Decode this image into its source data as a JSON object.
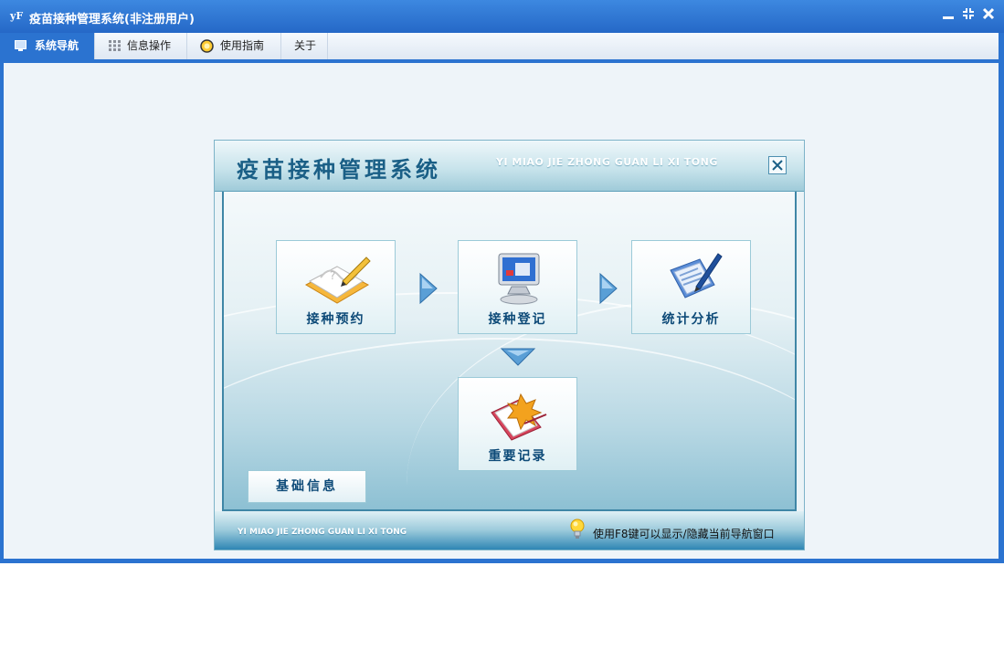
{
  "window": {
    "title": "疫苗接种管理系统(非注册用户)",
    "app_icon": "yF",
    "minimize": "‗",
    "restore": "⁜",
    "close": "✕"
  },
  "menu": {
    "items": [
      {
        "label": "系统导航",
        "icon": "monitor-icon",
        "active": true
      },
      {
        "label": "信息操作",
        "icon": "grid-icon",
        "active": false
      },
      {
        "label": "使用指南",
        "icon": "help-circle-icon",
        "active": false
      },
      {
        "label": "关于",
        "icon": "",
        "active": false
      }
    ]
  },
  "panel": {
    "title": "疫苗接种管理系统",
    "title_en": "YI MIAO JIE ZHONG GUAN LI XI TONG",
    "close": "✕",
    "tiles": {
      "appointment": "接种预约",
      "registration": "接种登记",
      "statistics": "统计分析",
      "records": "重要记录"
    },
    "basic_info": "基础信息",
    "footer_en": "YI MIAO JIE ZHONG GUAN LI XI TONG",
    "footer_hint": "使用F8键可以显示/隐藏当前导航窗口"
  },
  "colors": {
    "titlebar": "#2b73d0",
    "accent": "#0d4a78",
    "content_bg": "#eef4f9"
  }
}
